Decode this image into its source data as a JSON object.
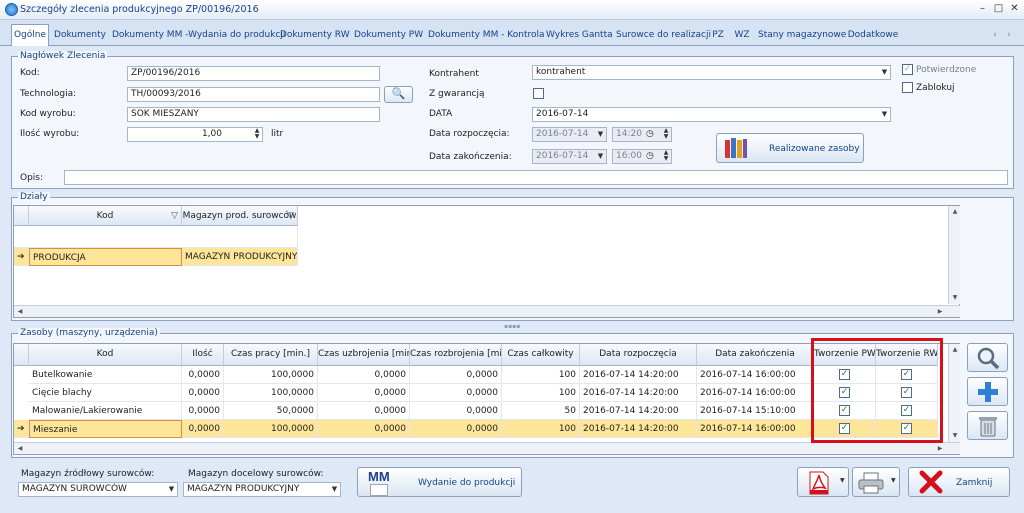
{
  "window": {
    "title": "Szczegóły zlecenia produkcyjnego ZP/00196/2016"
  },
  "tabs": [
    "Ogólne",
    "Dokumenty",
    "Dokumenty MM -Wydania do produkcji",
    "Dokumenty RW",
    "Dokumenty PW",
    "Dokumenty MM - Kontrola",
    "Wykres Gantta",
    "Surowce do realizacji",
    "PZ",
    "WZ",
    "Stany magazynowe",
    "Dodatkowe"
  ],
  "header": {
    "group": "Nagłówek Zlecenia",
    "kod_label": "Kod:",
    "kod": "ZP/00196/2016",
    "tech_label": "Technologia:",
    "tech": "TH/00093/2016",
    "wyrob_label": "Kod wyrobu:",
    "wyrob": "SOK MIESZANY",
    "ilosc_label": "Ilość wyrobu:",
    "ilosc": "1,00",
    "unit": "litr",
    "kontrahent_label": "Kontrahent",
    "kontrahent": "kontrahent",
    "gwarancja_label": "Z gwarancją",
    "data_label": "DATA",
    "data": "2016-07-14",
    "start_label": "Data rozpoczęcia:",
    "start_date": "2016-07-14",
    "start_time": "14:20",
    "end_label": "Data zakończenia:",
    "end_date": "2016-07-14",
    "end_time": "16:00",
    "potwierdzone": "Potwierdzone",
    "zablokuj": "Zablokuj",
    "realizowane": "Realizowane zasoby",
    "opis_label": "Opis:",
    "opis": ""
  },
  "dzialy": {
    "group": "Działy",
    "cols": [
      "Kod",
      "Magazyn prod. surowców"
    ],
    "rows": [
      [
        "PRODUKCJA",
        "MAGAZYN PRODUKCYJNY"
      ]
    ]
  },
  "zasoby": {
    "group": "Zasoby (maszyny, urządzenia)",
    "cols": [
      "Kod",
      "Ilość",
      "Czas pracy [min.]",
      "Czas uzbrojenia [min.]",
      "Czas rozbrojenia [min.]",
      "Czas całkowity",
      "Data rozpoczęcia",
      "Data zakończenia",
      "Tworzenie PW",
      "Tworzenie RW"
    ],
    "rows": [
      [
        "Butelkowanie",
        "0,0000",
        "100,0000",
        "0,0000",
        "0,0000",
        "100",
        "2016-07-14 14:20:00",
        "2016-07-14 16:00:00"
      ],
      [
        "Cięcie blachy",
        "0,0000",
        "100,0000",
        "0,0000",
        "0,0000",
        "100",
        "2016-07-14 14:20:00",
        "2016-07-14 16:00:00"
      ],
      [
        "Malowanie/Lakierowanie",
        "0,0000",
        "50,0000",
        "0,0000",
        "0,0000",
        "50",
        "2016-07-14 14:20:00",
        "2016-07-14 15:10:00"
      ],
      [
        "Mieszanie",
        "0,0000",
        "100,0000",
        "0,0000",
        "0,0000",
        "100",
        "2016-07-14 14:20:00",
        "2016-07-14 16:00:00"
      ]
    ]
  },
  "footer": {
    "zrodlowy_label": "Magazyn źródłowy surowców:",
    "zrodlowy": "MAGAZYN SUROWCÓW",
    "docelowy_label": "Magazyn docelowy surowców:",
    "docelowy": "MAGAZYN PRODUKCYJNY",
    "mm_icon_text": "MM",
    "wydanie": "Wydanie do produkcji",
    "zamknij": "Zamknij"
  }
}
